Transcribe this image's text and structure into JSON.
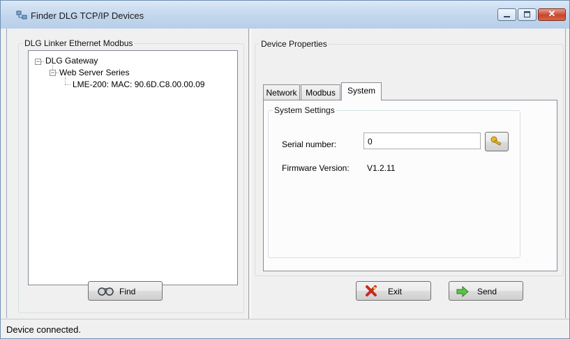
{
  "window": {
    "title": "Finder DLG TCP/IP Devices"
  },
  "left_panel": {
    "group_title": "DLG Linker Ethernet Modbus",
    "tree": {
      "root": "DLG Gateway",
      "child": "Web Server Series",
      "leaf": "LME-200: MAC: 90.6D.C8.00.00.09"
    },
    "find_button": "Find"
  },
  "right_panel": {
    "group_title": "Device Properties",
    "tabs": [
      "Network",
      "Modbus",
      "System"
    ],
    "active_tab": "System",
    "system_settings": {
      "group_title": "System Settings",
      "serial_label": "Serial number:",
      "serial_value": "0",
      "firmware_label": "Firmware Version:",
      "firmware_value": "V1.2.11"
    },
    "exit_button": "Exit",
    "send_button": "Send"
  },
  "status": {
    "text": "Device connected."
  },
  "icons": {
    "app": "network-devices-icon",
    "find": "binoculars-icon",
    "exit": "red-x-icon",
    "send": "green-arrow-icon",
    "serial_action": "key-icon"
  }
}
